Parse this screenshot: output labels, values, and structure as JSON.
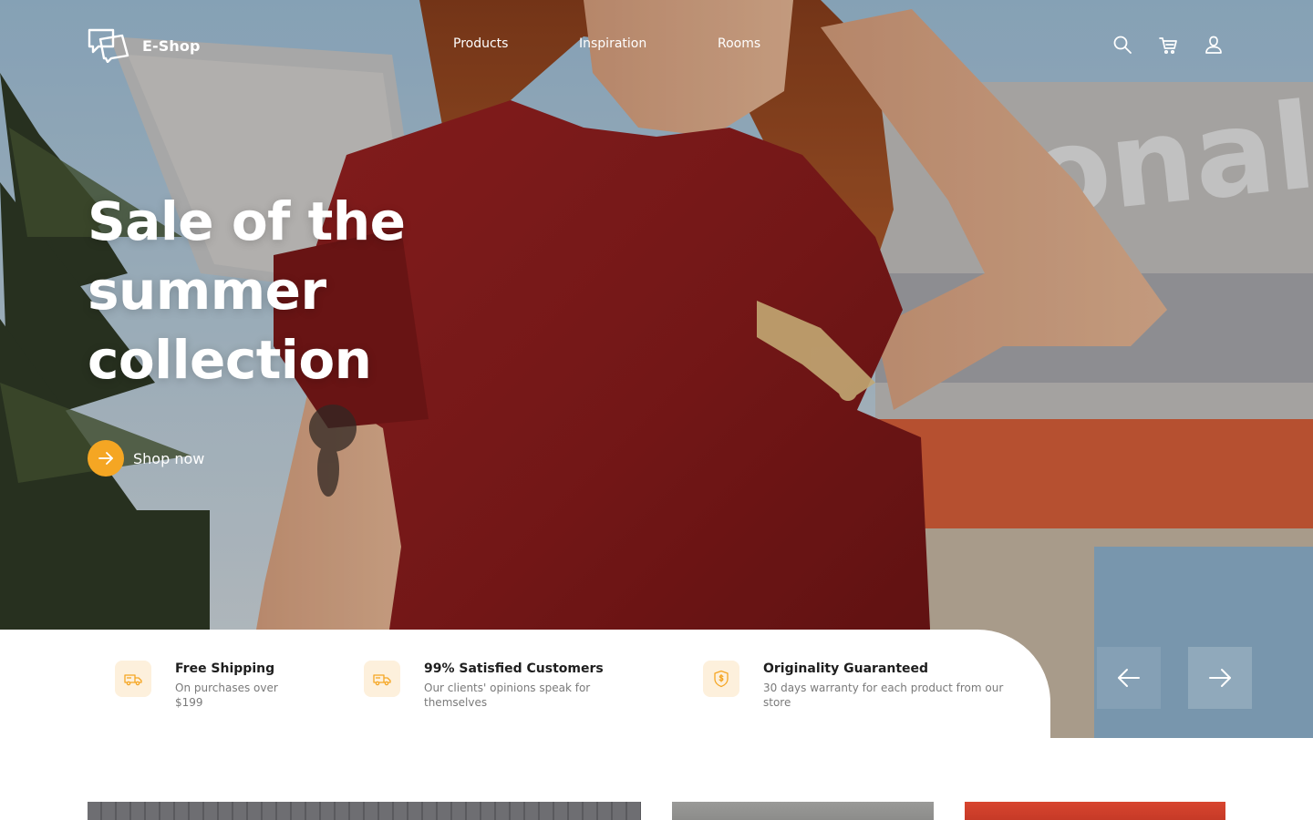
{
  "brand": {
    "name": "E-Shop",
    "logo_icon": "chat-bubbles-icon"
  },
  "nav": {
    "items": [
      {
        "label": "Products"
      },
      {
        "label": "Inspiration"
      },
      {
        "label": "Rooms"
      }
    ]
  },
  "header_icons": [
    "search-icon",
    "cart-icon",
    "user-icon"
  ],
  "hero": {
    "title": "Sale of the summer collection",
    "cta_label": "Shop now",
    "cta_icon": "arrow-right-icon"
  },
  "features": [
    {
      "icon": "truck-icon",
      "title": "Free Shipping",
      "description": "On purchases over $199"
    },
    {
      "icon": "truck-icon",
      "title": "99% Satisfied Customers",
      "description": "Our clients' opinions speak for themselves"
    },
    {
      "icon": "shield-dollar-icon",
      "title": "Originality Guaranteed",
      "description": "30 days warranty for each product from our store"
    }
  ],
  "slider": {
    "prev_icon": "arrow-left-icon",
    "next_icon": "arrow-right-icon"
  },
  "colors": {
    "accent": "#f5a623",
    "accent_soft": "#fdf0dc",
    "text_dark": "#1e1e1e",
    "text_muted": "#7a7a7a",
    "shirt_red": "#8e1d1d",
    "hair_copper": "#a8532a"
  }
}
